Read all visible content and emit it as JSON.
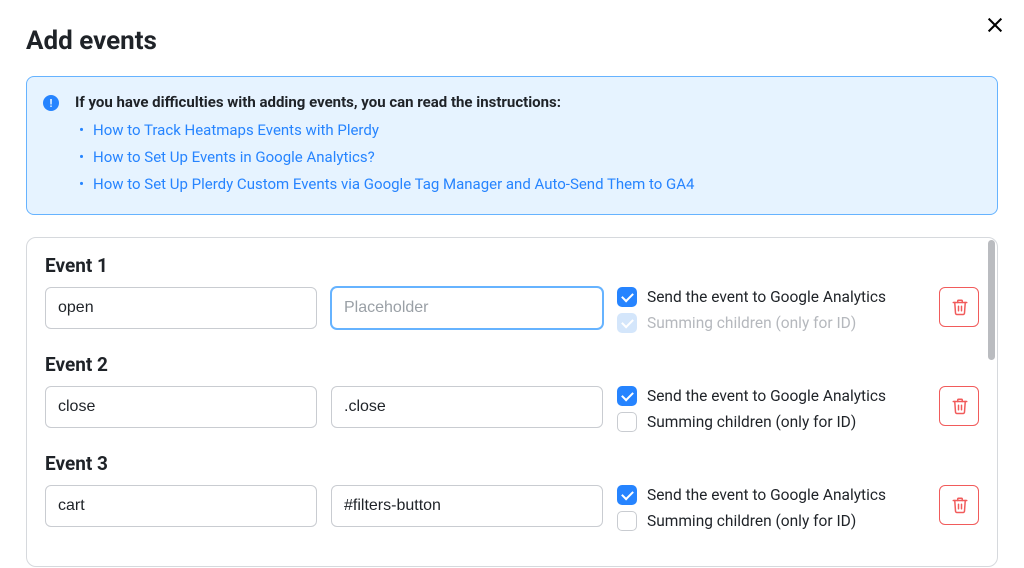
{
  "header": {
    "title": "Add events"
  },
  "info": {
    "title": "If you have difficulties with adding events, you can read the instructions:",
    "links": [
      "How to Track Heatmaps Events with Plerdy",
      "How to Set Up Events in Google Analytics?",
      "How to Set Up Plerdy Custom Events via Google Tag Manager and Auto-Send Them to GA4"
    ]
  },
  "labels": {
    "send_ga": "Send the event to Google Analytics",
    "summing": "Summing children (only for ID)",
    "selector_placeholder": "Placeholder"
  },
  "events": [
    {
      "title": "Event 1",
      "name_value": "open",
      "selector_value": "",
      "selector_focused": true,
      "send_ga": true,
      "summing": false,
      "summing_disabled": true
    },
    {
      "title": "Event 2",
      "name_value": "close",
      "selector_value": ".close",
      "selector_focused": false,
      "send_ga": true,
      "summing": false,
      "summing_disabled": false
    },
    {
      "title": "Event 3",
      "name_value": "cart",
      "selector_value": "#filters-button",
      "selector_focused": false,
      "send_ga": true,
      "summing": false,
      "summing_disabled": false
    }
  ]
}
